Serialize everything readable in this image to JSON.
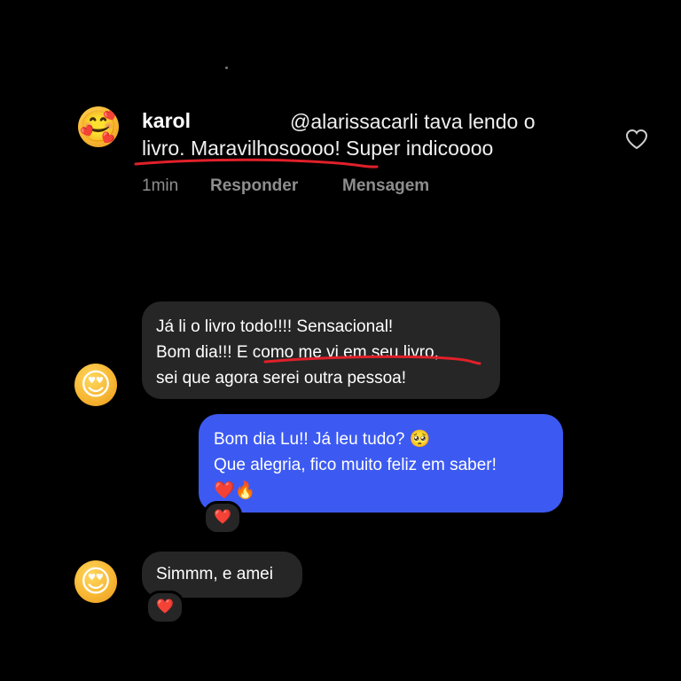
{
  "comment": {
    "username": "karol",
    "mention_text": "@alarissacarli tava lendo o",
    "line2_text": "livro. Maravilhosoooo! Super indicoooo",
    "time": "1min",
    "reply_label": "Responder",
    "message_label": "Mensagem",
    "avatar_emoji": "🥰",
    "like_icon": "heart-outline-icon"
  },
  "chat": {
    "messages": [
      {
        "from": "received",
        "lines": [
          "Já li o livro todo!!!! Sensacional!",
          "Bom dia!!! E como me vi em seu livro,",
          "sei que agora serei outra pessoa!"
        ],
        "avatar_emoji": "😍"
      },
      {
        "from": "sent",
        "lines": [
          "Bom dia Lu!! Já leu tudo? 🥺",
          "Que alegria, fico muito feliz em saber!",
          "❤️🔥"
        ],
        "reaction": "❤️"
      },
      {
        "from": "received",
        "lines": [
          "Simmm, e amei"
        ],
        "avatar_emoji": "😍",
        "reaction": "❤️"
      }
    ]
  },
  "colors": {
    "background": "#000000",
    "received_bubble": "#262626",
    "sent_bubble": "#3c5af2",
    "annotation_underline": "#e0202a",
    "muted_text": "#8e8e8e"
  }
}
